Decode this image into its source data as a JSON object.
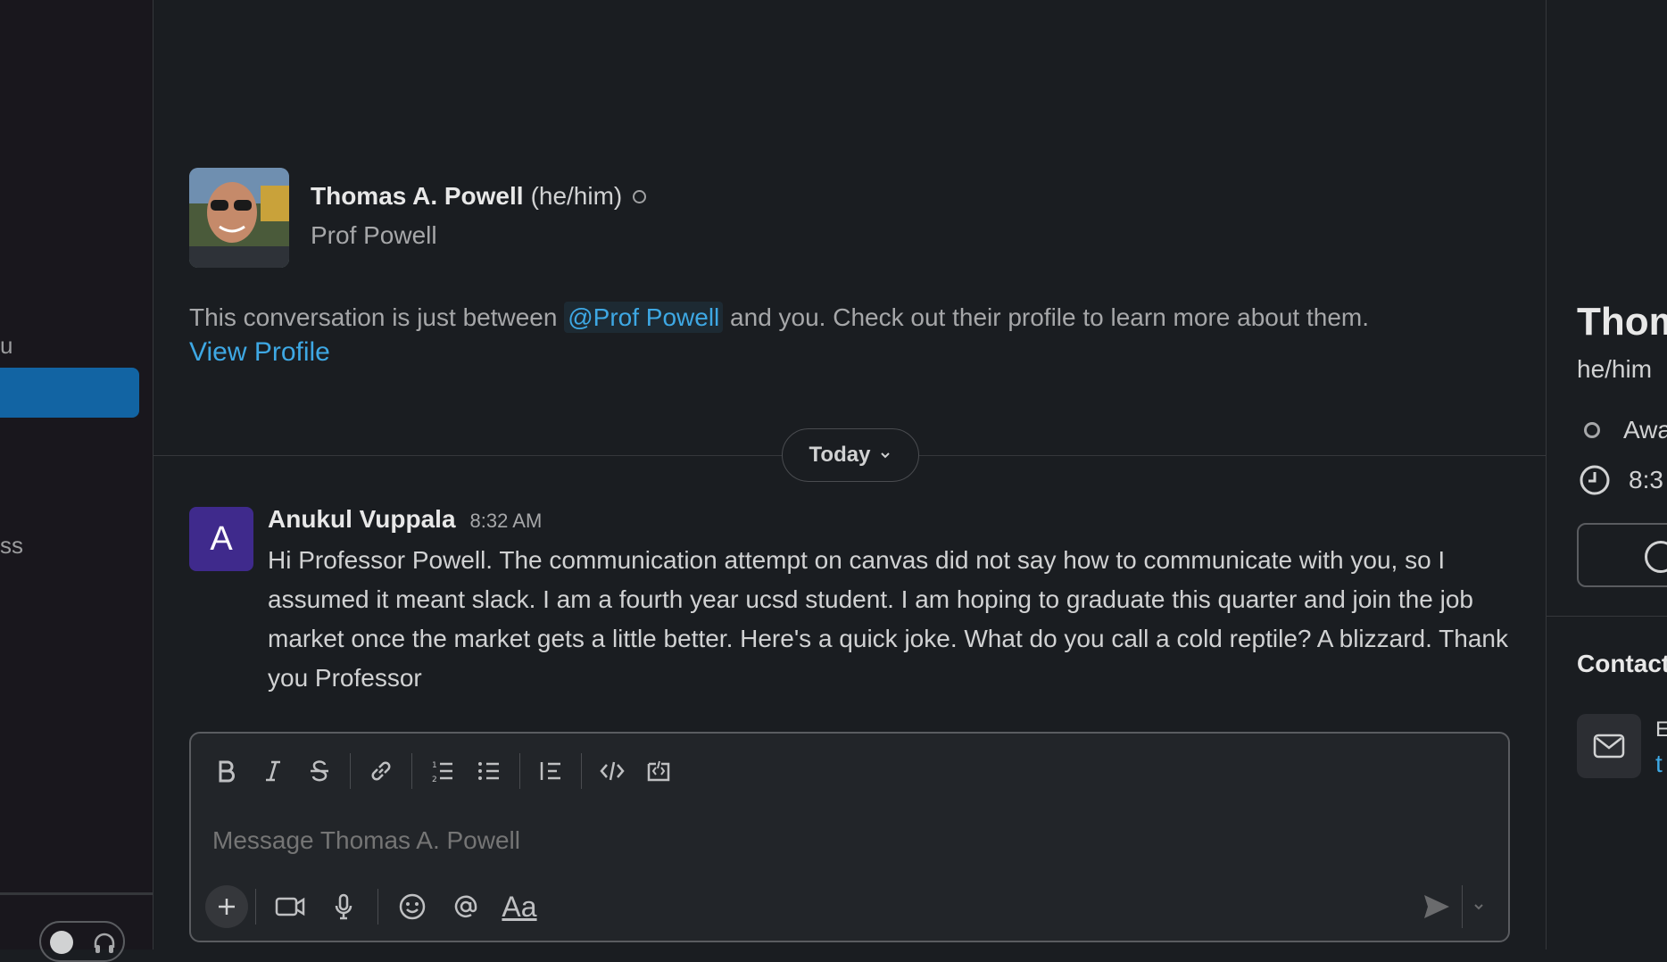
{
  "sidebar": {
    "fragment_1": "u",
    "fragment_2": "ss"
  },
  "profile": {
    "full_name": "Thomas A. Powell",
    "pronouns": "(he/him)",
    "display_name": "Prof Powell"
  },
  "intro": {
    "before": "This conversation is just between ",
    "mention": "@Prof Powell",
    "after": " and you. Check out their profile to learn more about them.",
    "view_profile": "View Profile"
  },
  "divider": {
    "label": "Today"
  },
  "message": {
    "avatar_letter": "A",
    "author": "Anukul Vuppala",
    "time": "8:32 AM",
    "text": "Hi Professor Powell. The communication attempt on canvas did not say how to communicate with you, so I assumed it meant slack. I am a fourth year ucsd student. I am hoping to graduate this quarter and join the job market once the market gets a little better. Here's a quick joke. What do you call a cold reptile? A blizzard. Thank you Professor"
  },
  "composer": {
    "placeholder": "Message Thomas A. Powell",
    "format_label": "Aa"
  },
  "right_panel": {
    "name": "Thom",
    "pronouns": "he/him",
    "status": "Awa",
    "local_time": "8:3",
    "contact_heading": "Contact",
    "email_label": "E",
    "email_value": "t"
  },
  "colors": {
    "accent": "#1264a3",
    "link": "#3ea8e4",
    "avatar_bg": "#3f2a8c",
    "background": "#1a1d21"
  }
}
